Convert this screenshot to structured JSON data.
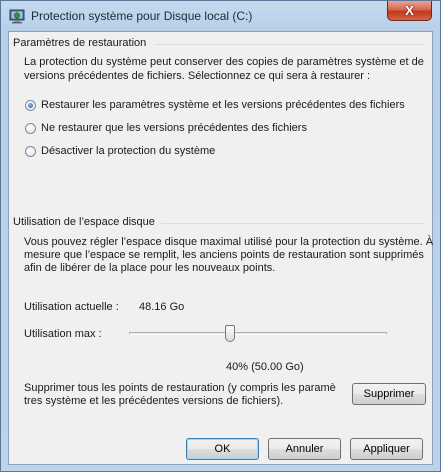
{
  "window": {
    "title": "Protection système pour Disque local (C:)",
    "close_label": "X"
  },
  "restore": {
    "heading": "Paramètres de restauration",
    "description": [
      "La protection du système peut conserver des copies de paramètres système et de",
      "versions précédentes de fichiers. Sélectionnez ce qui sera à restaurer :"
    ],
    "options": [
      {
        "label": "Restaurer les paramètres système et les versions précédentes des fichiers",
        "checked": true
      },
      {
        "label": "Ne restaurer que les versions précédentes des fichiers",
        "checked": false
      },
      {
        "label": "Désactiver la protection du système",
        "checked": false
      }
    ]
  },
  "disk": {
    "heading": "Utilisation de l’espace disque",
    "description": [
      "Vous pouvez régler l’espace disque maximal utilisé pour la protection du système. À",
      "mesure que l’espace se remplit, les anciens points de restauration sont supprimés",
      "afin de libérer de la place pour les nouveaux points."
    ],
    "current_label": "Utilisation actuelle :",
    "current_value": "48.16 Go",
    "max_label": "Utilisation max :",
    "max_fraction": 0.4,
    "max_value_text": "40% (50.00 Go)",
    "delete_text": [
      "Supprimer tous les points de restauration (y compris les paramè",
      "tres système et les précédentes versions de fichiers)."
    ],
    "delete_button": "Supprimer"
  },
  "footer": {
    "ok": "OK",
    "cancel": "Annuler",
    "apply": "Appliquer"
  },
  "colors": {
    "title_bar": "#c7daee",
    "client_bg": "#f0f0f0",
    "close_red": "#c2391c",
    "default_button_border": "#3c7fb1"
  },
  "icons": {
    "app": "system-protection-icon",
    "close": "close-icon"
  }
}
